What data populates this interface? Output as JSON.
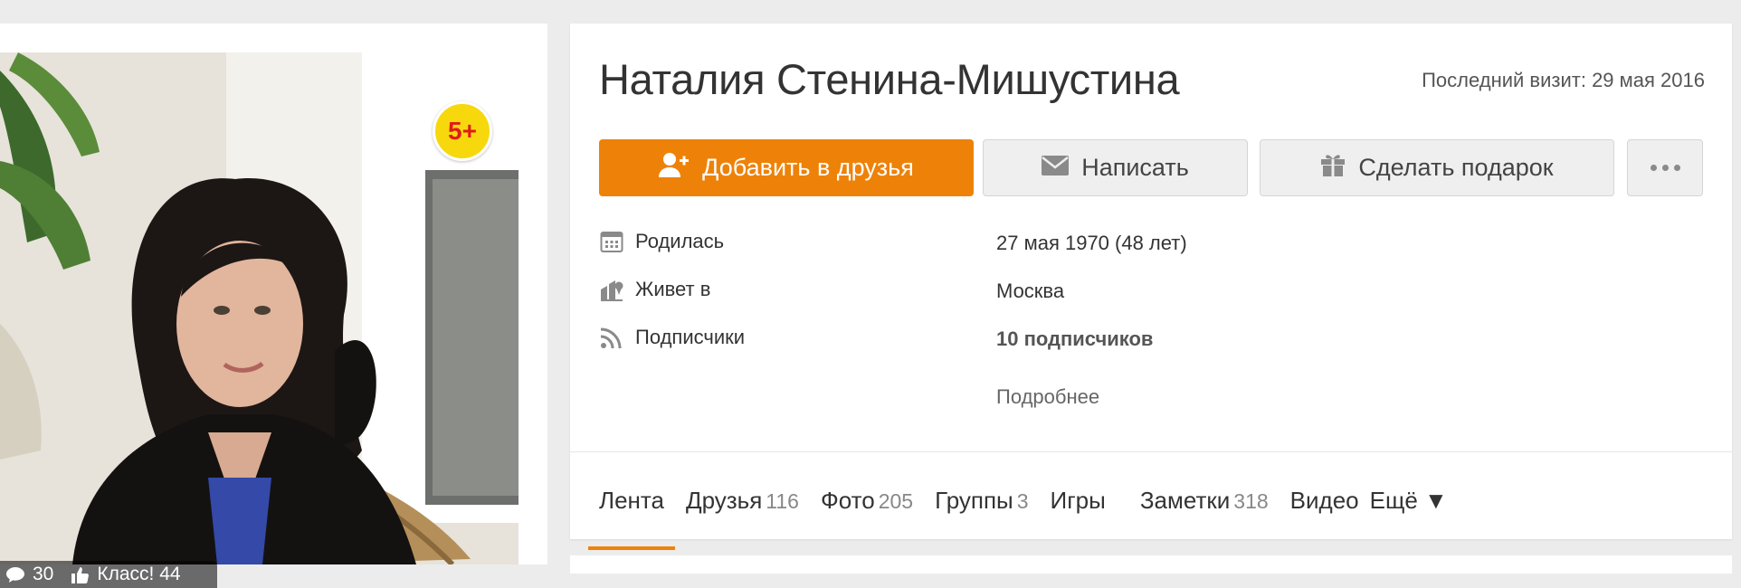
{
  "photo": {
    "age_badge": "5+",
    "comments_count": "30",
    "class_label": "Класс! 44"
  },
  "profile": {
    "name": "Наталия Стенина-Мишустина",
    "last_visit": "Последний визит: 29 мая 2016"
  },
  "actions": {
    "add_friend": "Добавить в друзья",
    "message": "Написать",
    "gift": "Сделать подарок",
    "more_icon": "more-dots-icon"
  },
  "info": [
    {
      "label": "Родилась",
      "value": "27 мая 1970 (48 лет)",
      "icon": "calendar-icon"
    },
    {
      "label": "Живет в",
      "value": "Москва",
      "icon": "location-icon"
    },
    {
      "label": "Подписчики",
      "value": "10 подписчиков",
      "icon": "rss-icon"
    }
  ],
  "more_link": "Подробнее",
  "tabs": [
    {
      "label": "Лента",
      "count": ""
    },
    {
      "label": "Друзья",
      "count": "116"
    },
    {
      "label": "Фото",
      "count": "205"
    },
    {
      "label": "Группы",
      "count": "3"
    },
    {
      "label": "Игры",
      "count": ""
    },
    {
      "label": "Заметки",
      "count": "318"
    },
    {
      "label": "Видео",
      "count": ""
    },
    {
      "label": "Ещё ▼",
      "count": ""
    }
  ],
  "colors": {
    "accent": "#ee8208",
    "badge": "#f7d80d",
    "badge_text": "#e01b1b",
    "background": "#ececec"
  }
}
